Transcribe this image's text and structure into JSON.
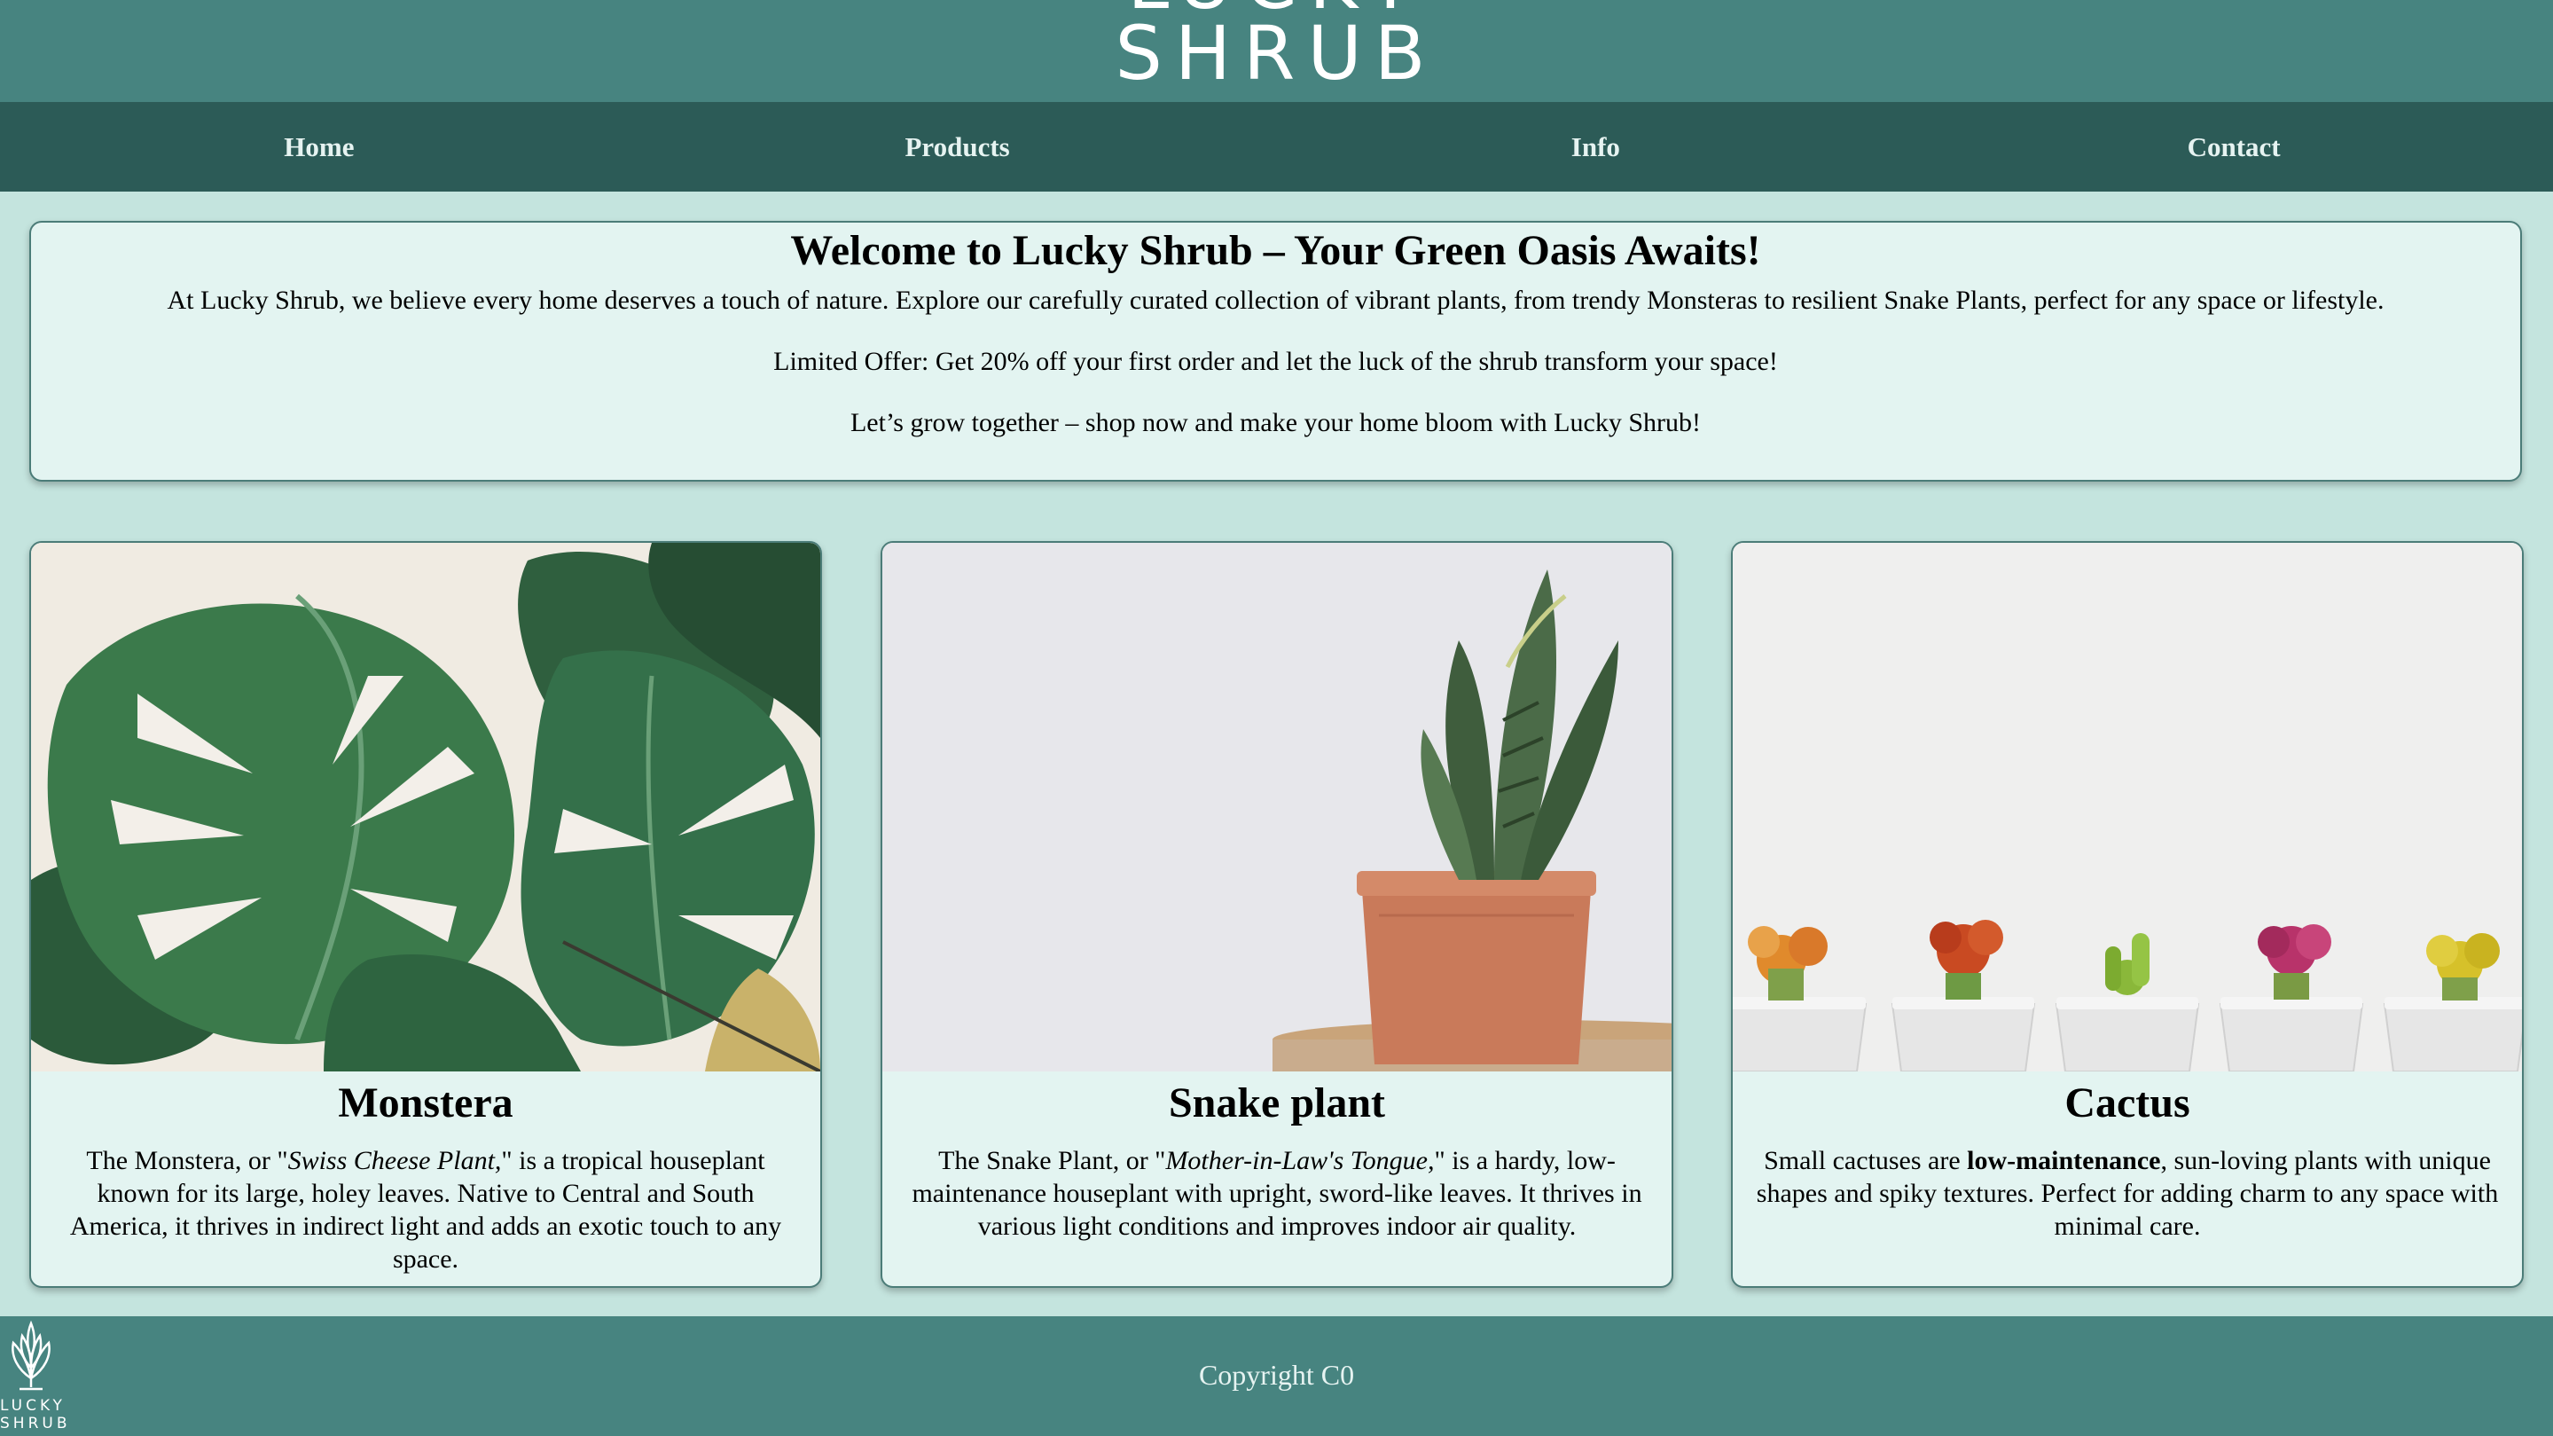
{
  "brand": {
    "logo_line1": "LUCKY",
    "logo_line2": "SHRUB"
  },
  "nav": {
    "items": [
      {
        "label": "Home"
      },
      {
        "label": "Products"
      },
      {
        "label": "Info"
      },
      {
        "label": "Contact"
      }
    ]
  },
  "welcome": {
    "title": "Welcome to Lucky Shrub – Your Green Oasis Awaits!",
    "paragraph1": "At Lucky Shrub, we believe every home deserves a touch of nature. Explore our carefully curated collection of vibrant plants, from trendy Monsteras to resilient Snake Plants, perfect for any space or lifestyle.",
    "paragraph2": "Limited Offer: Get 20% off your first order and let the luck of the shrub transform your space!",
    "paragraph3": "Let’s grow together – shop now and make your home bloom with Lucky Shrub!"
  },
  "products": [
    {
      "title": "Monstera",
      "desc_before": "The Monstera, or \"",
      "desc_emph": "Swiss Cheese Plant,",
      "desc_after": "\" is a tropical houseplant known for its large, holey leaves. Native to Central and South America, it thrives in indirect light and adds an exotic touch to any space.",
      "image_icon": "monstera-leaves"
    },
    {
      "title": "Snake plant",
      "desc_before": "The Snake Plant, or \"",
      "desc_emph": "Mother-in-Law's Tongue,",
      "desc_after": "\" is a hardy, low-maintenance houseplant with upright, sword-like leaves. It thrives in various light conditions and improves indoor air quality.",
      "image_icon": "snake-plant-pot"
    },
    {
      "title": "Cactus",
      "desc_before": "Small cactuses are ",
      "desc_emph": "low-maintenance",
      "desc_after": ", sun-loving plants with unique shapes and spiky textures. Perfect for adding charm to any space with minimal care.",
      "image_icon": "cactus-pots"
    }
  ],
  "footer": {
    "copyright": "Copyright C0",
    "logo_line1": "LUCKY",
    "logo_line2": "SHRUB"
  },
  "colors": {
    "page_bg": "#c4e4de",
    "header_bg": "#478480",
    "nav_bg": "#2c5b57",
    "card_bg": "#e3f4f1",
    "border": "#4b7c78"
  }
}
